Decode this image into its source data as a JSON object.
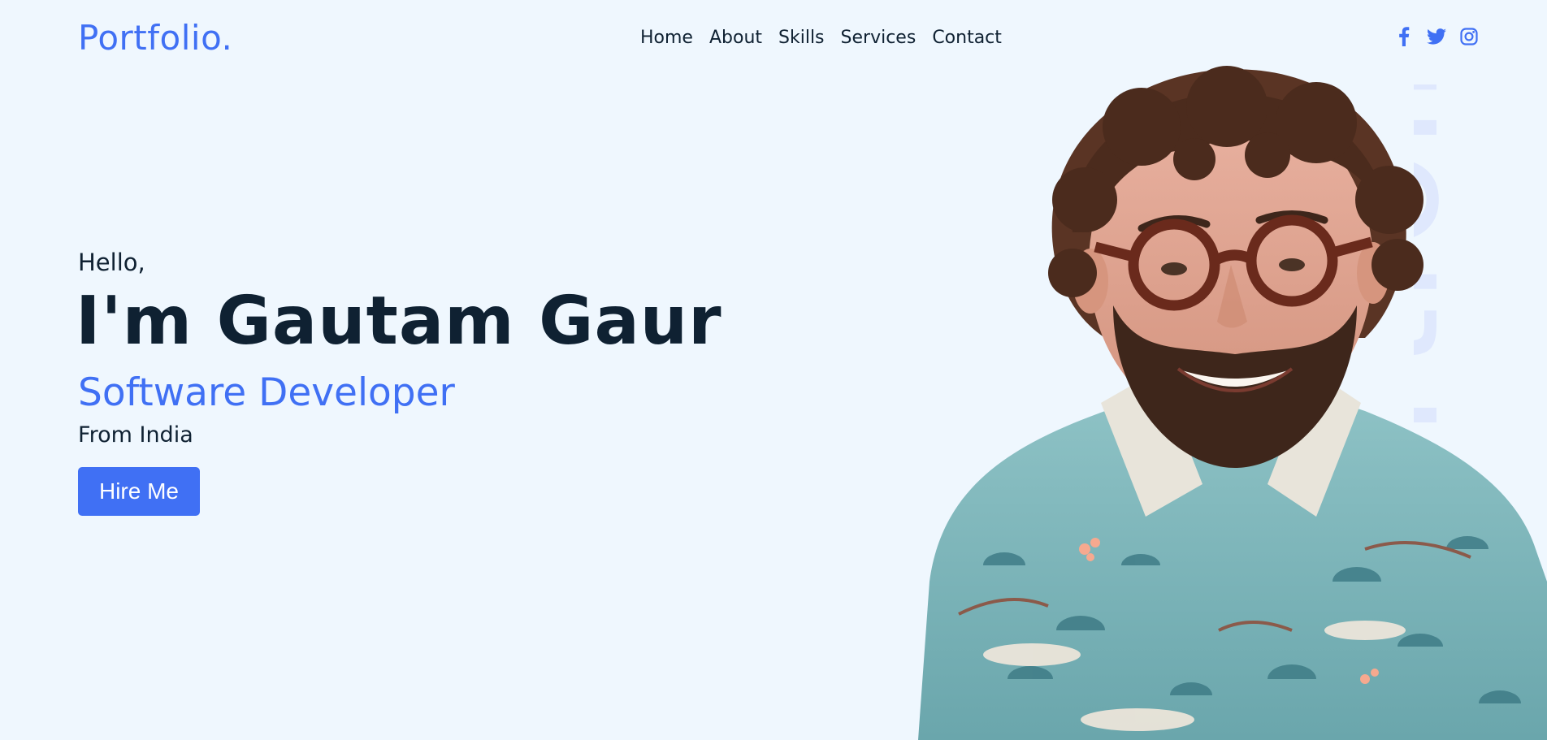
{
  "header": {
    "logo": "Portfolio.",
    "nav": [
      {
        "label": "Home"
      },
      {
        "label": "About"
      },
      {
        "label": "Skills"
      },
      {
        "label": "Services"
      },
      {
        "label": "Contact"
      }
    ],
    "social_icons": [
      "facebook-icon",
      "twitter-icon",
      "instagram-icon"
    ]
  },
  "hero": {
    "greeting": "Hello,",
    "name": "I'm Gautam Gaur",
    "role": "Software Developer",
    "location": "From India",
    "cta_label": "Hire Me",
    "background_word": "Portfolio"
  },
  "colors": {
    "accent": "#4070f4",
    "background": "#eff7fe",
    "text_dark": "#0f2132",
    "watermark": "#dfe8fd"
  }
}
